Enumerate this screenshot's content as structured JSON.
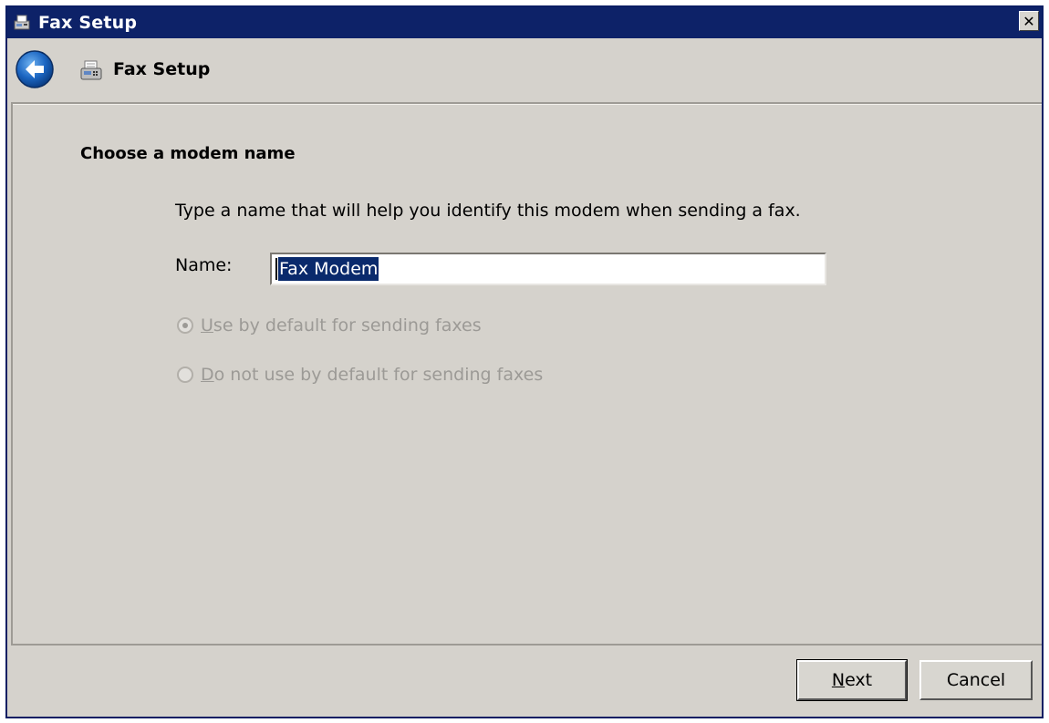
{
  "window": {
    "title": "Fax Setup",
    "close_glyph": "✕"
  },
  "header": {
    "title": "Fax Setup",
    "back_icon": "back-arrow-icon",
    "app_icon": "fax-machine-icon"
  },
  "page": {
    "heading": "Choose a modem name",
    "description": "Type a name that will help you identify this modem when sending a fax.",
    "name_label": "Name:",
    "name_value": "Fax Modem"
  },
  "options": {
    "use_default": {
      "prefix": "",
      "underlined": "U",
      "rest": "se by default for sending faxes",
      "selected": true,
      "enabled": false
    },
    "not_default": {
      "prefix": "",
      "underlined": "D",
      "rest": "o not use by default for sending faxes",
      "selected": false,
      "enabled": false
    }
  },
  "buttons": {
    "next": {
      "underlined": "N",
      "rest": "ext"
    },
    "cancel": "Cancel"
  },
  "colors": {
    "titlebar": "#0d2268",
    "dialog_bg": "#d5d2cc",
    "selection": "#0a2a6c",
    "disabled_text": "#9c9a96"
  }
}
